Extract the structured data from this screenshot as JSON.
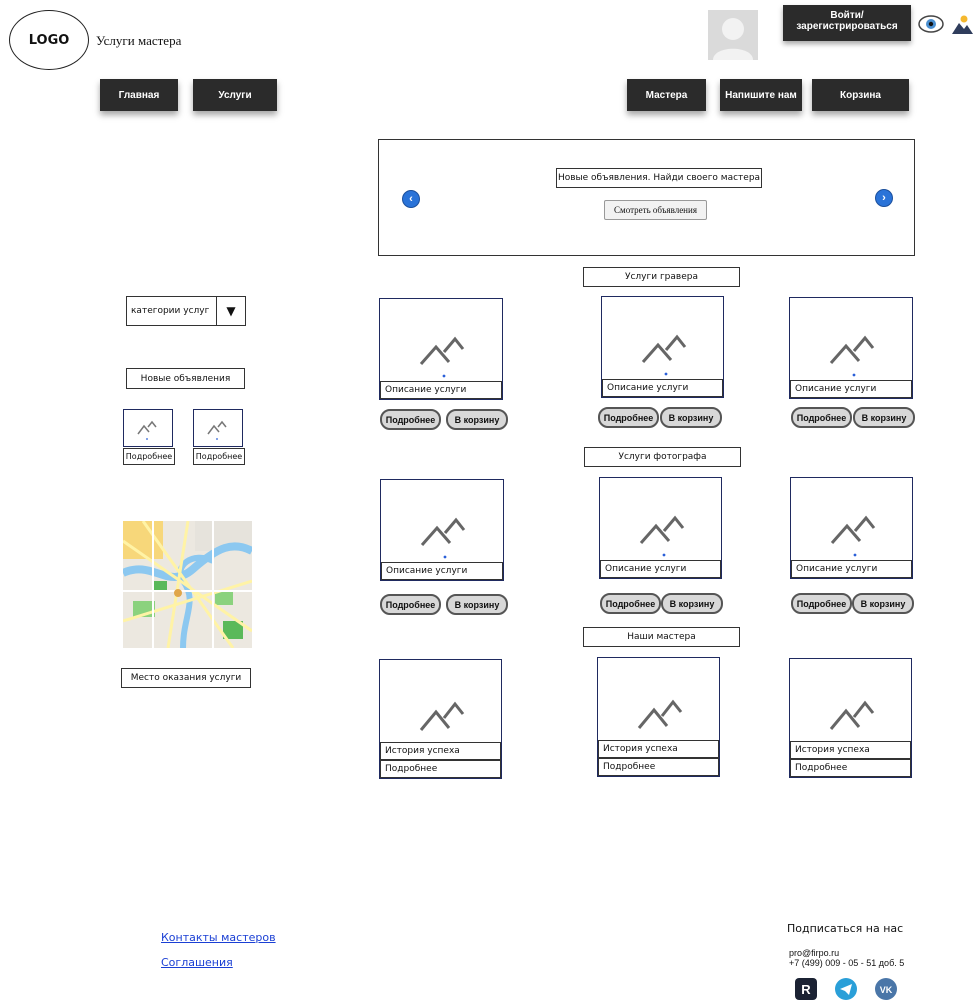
{
  "header": {
    "logo": "LOGO",
    "site_title": "Услуги мастера",
    "login_button": "Войти/ зарегистрироваться",
    "icons": [
      "eye-icon",
      "theme-icon"
    ]
  },
  "nav": {
    "home": "Главная",
    "services": "Услуги",
    "masters": "Мастера",
    "write_us": "Напишите нам",
    "cart": "Корзина"
  },
  "slider": {
    "caption": "Новые объявления. Найди своего мастера",
    "button": "Смотреть объявления"
  },
  "sidebar": {
    "category_select": "категории услуг",
    "new_ads_label": "Новые объявления",
    "mini_cards": [
      {
        "button": "Подробнее"
      },
      {
        "button": "Подробнее"
      }
    ],
    "map_label": "Место оказания услуги"
  },
  "sections": [
    {
      "title": "Услуги гравера",
      "cards": [
        {
          "caption": "Описание услуги",
          "details": "Подробнее",
          "cart": "В корзину"
        },
        {
          "caption": "Описание услуги",
          "details": "Подробнее",
          "cart": "В корзину"
        },
        {
          "caption": "Описание услуги",
          "details": "Подробнее",
          "cart": "В корзину"
        }
      ]
    },
    {
      "title": "Услуги фотографа",
      "cards": [
        {
          "caption": "Описание услуги",
          "details": "Подробнее",
          "cart": "В корзину"
        },
        {
          "caption": "Описание услуги",
          "details": "Подробнее",
          "cart": "В корзину"
        },
        {
          "caption": "Описание услуги",
          "details": "Подробнее",
          "cart": "В корзину"
        }
      ]
    },
    {
      "title": "Наши мастера",
      "cards": [
        {
          "caption": "История успеха",
          "details": "Подробнее"
        },
        {
          "caption": "История успеха",
          "details": "Подробнее"
        },
        {
          "caption": "История успеха",
          "details": "Подробнее"
        }
      ]
    }
  ],
  "footer": {
    "links": [
      "Контакты мастеров",
      "Соглашения"
    ],
    "subscribe": "Подписаться на нас",
    "email": "pro@firpo.ru",
    "phone": "+7 (499) 009 - 05 - 51 доб. 5",
    "social_icons": [
      "rutube-icon",
      "telegram-icon",
      "vk-icon"
    ],
    "social_letters": {
      "rutube": "R",
      "vk": "VK"
    }
  }
}
